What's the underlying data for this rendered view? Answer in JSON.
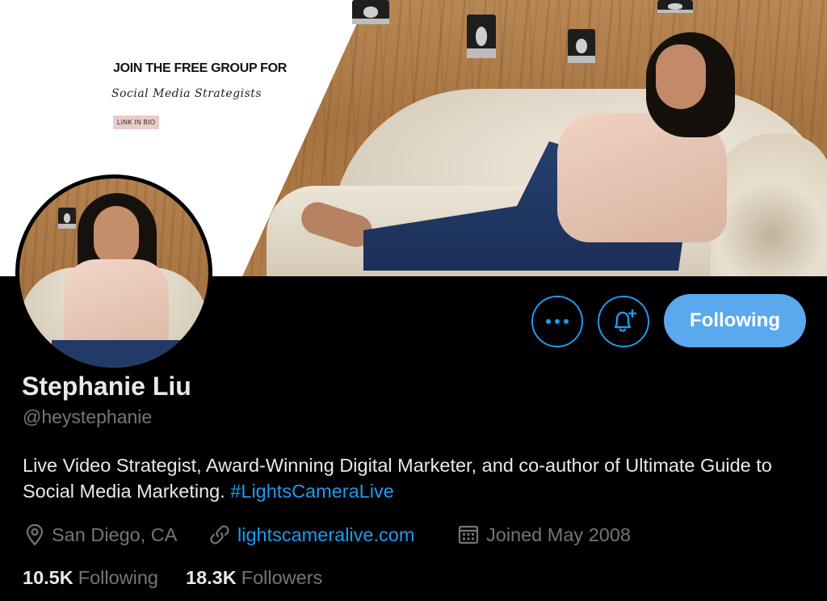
{
  "banner": {
    "promo_title": "JOIN THE FREE GROUP FOR",
    "promo_script": "Social Media Strategists",
    "promo_tag": "LINK IN BIO"
  },
  "actions": {
    "more_icon": "more-horizontal-icon",
    "notify_icon": "bell-plus-icon",
    "follow_label": "Following"
  },
  "profile": {
    "name": "Stephanie Liu",
    "handle": "@heystephanie",
    "bio_text": "Live Video Strategist, Award-Winning Digital Marketer, and co-author of Ultimate Guide to Social Media Marketing. ",
    "bio_hashtag": "#LightsCameraLive",
    "location": "San Diego, CA",
    "website": "lightscameralive.com",
    "joined": "Joined May 2008"
  },
  "stats": {
    "following_count": "10.5K",
    "following_label": "Following",
    "followers_count": "18.3K",
    "followers_label": "Followers"
  },
  "colors": {
    "accent": "#1d9bf0",
    "follow_button": "#5aa9ee",
    "primary_text": "#e7e9ea",
    "secondary_text": "#71767b",
    "background": "#000000"
  }
}
